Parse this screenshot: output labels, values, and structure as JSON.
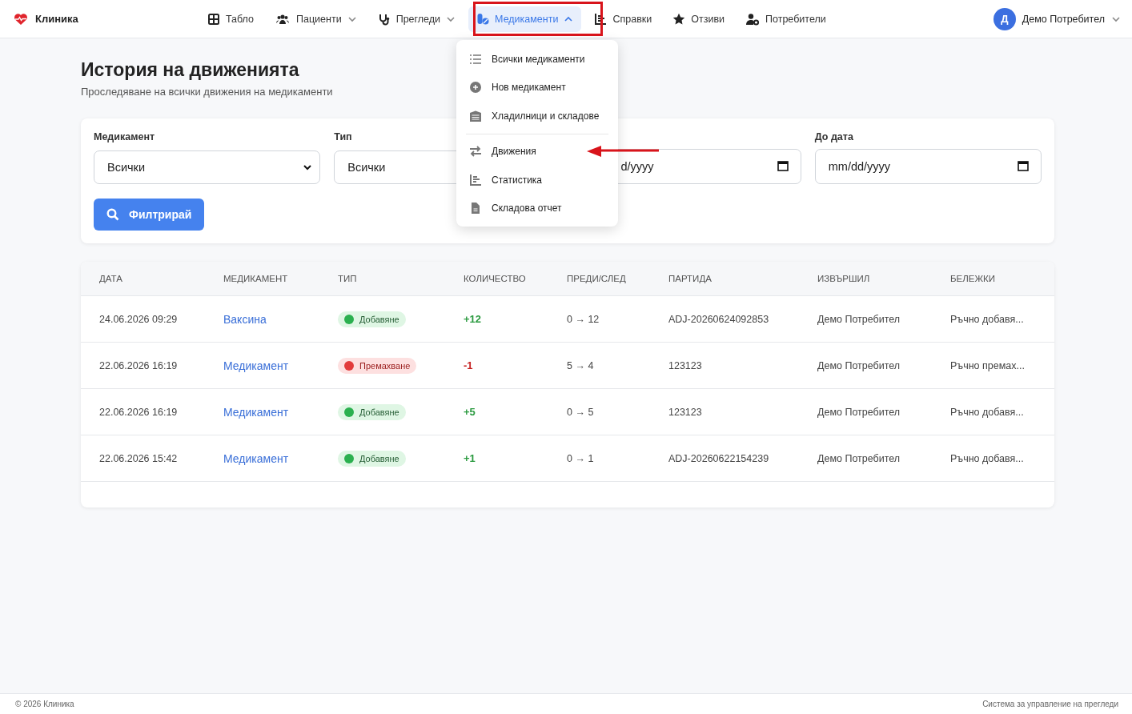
{
  "brand": "Клиника",
  "nav": [
    {
      "label": "Табло",
      "selected": false
    },
    {
      "label": "Пациенти",
      "selected": false,
      "expanded": false
    },
    {
      "label": "Прегледи",
      "selected": false,
      "expanded": false
    },
    {
      "label": "Медикаменти",
      "selected": true,
      "expanded": true
    },
    {
      "label": "Справки",
      "selected": false
    },
    {
      "label": "Отзиви",
      "selected": false
    },
    {
      "label": "Потребители",
      "selected": false
    }
  ],
  "user": {
    "initial": "Д",
    "name": "Демо Потребител"
  },
  "menu": [
    {
      "label": "Всички медикаменти"
    },
    {
      "label": "Нов медикамент"
    },
    {
      "label": "Хладилници и складове"
    },
    {
      "label": "Движения"
    },
    {
      "label": "Статистика"
    },
    {
      "label": "Складова отчет"
    }
  ],
  "page": {
    "title": "История на движенията",
    "subtitle": "Проследяване на всички движения на медикаменти"
  },
  "filters": {
    "medication": {
      "label": "Медикамент",
      "value": "Всички"
    },
    "type": {
      "label": "Тип",
      "value": "Всички"
    },
    "date_from": {
      "placeholder": "d/yyyy"
    },
    "date_to": {
      "label": "До дата",
      "placeholder": "mm/dd/yyyy"
    },
    "button": "Филтрирай"
  },
  "table": {
    "columns": [
      "ДАТА",
      "МЕДИКАМЕНТ",
      "ТИП",
      "КОЛИЧЕСТВО",
      "ПРЕДИ/СЛЕД",
      "ПАРТИДА",
      "ИЗВЪРШИЛ",
      "БЕЛЕЖКИ"
    ],
    "rows": [
      {
        "date": "24.06.2026 09:29",
        "medication": "Ваксина",
        "type": "Добавяне",
        "kind": "add",
        "quantity": "+12",
        "before_after": "0 → 12",
        "batch": "ADJ-20260624092853",
        "user": "Демо Потребител",
        "notes": "Ръчно добавя..."
      },
      {
        "date": "22.06.2026 16:19",
        "medication": "Медикамент",
        "type": "Премахване",
        "kind": "remove",
        "quantity": "-1",
        "before_after": "5 → 4",
        "batch": "123123",
        "user": "Демо Потребител",
        "notes": "Ръчно премах..."
      },
      {
        "date": "22.06.2026 16:19",
        "medication": "Медикамент",
        "type": "Добавяне",
        "kind": "add",
        "quantity": "+5",
        "before_after": "0 → 5",
        "batch": "123123",
        "user": "Демо Потребител",
        "notes": "Ръчно добавя..."
      },
      {
        "date": "22.06.2026 15:42",
        "medication": "Медикамент",
        "type": "Добавяне",
        "kind": "add",
        "quantity": "+1",
        "before_after": "0 → 1",
        "batch": "ADJ-20260622154239",
        "user": "Демо Потребител",
        "notes": "Ръчно добавя..."
      }
    ]
  },
  "footer": {
    "left": "© 2026 Клиника",
    "right": "Система за управление на прегледи"
  }
}
